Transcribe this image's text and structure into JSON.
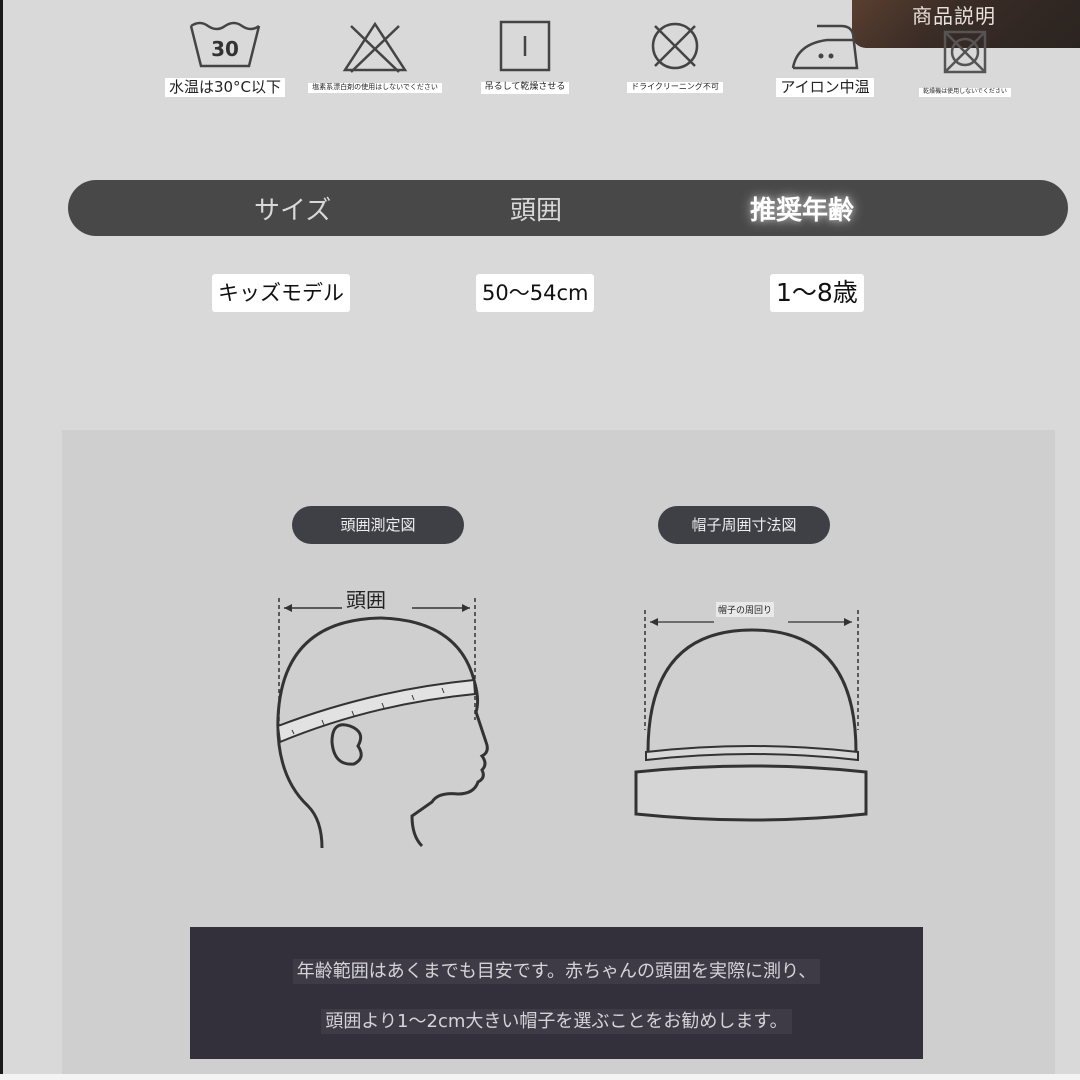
{
  "overlay": {
    "label": "商品説明"
  },
  "care": [
    {
      "icon": "wash-30-icon",
      "label": "水温は30°C以下",
      "number": "30"
    },
    {
      "icon": "no-bleach-icon",
      "label": "塩素系漂白剤の使用はしないでください"
    },
    {
      "icon": "hang-dry-icon",
      "label": "吊るして乾燥させる"
    },
    {
      "icon": "no-dry-clean-icon",
      "label": "ドライクリーニング不可"
    },
    {
      "icon": "iron-medium-icon",
      "label": "アイロン中温"
    },
    {
      "icon": "no-tumble-dry-icon",
      "label": "乾燥機は使用しないでください"
    }
  ],
  "size_table": {
    "headers": [
      "サイズ",
      "頭囲",
      "推奨年齢"
    ],
    "row": [
      "キッズモデル",
      "50〜54cm",
      "1〜8歳"
    ]
  },
  "diagrams": {
    "head": {
      "title": "頭囲測定図",
      "label": "頭囲"
    },
    "hat": {
      "title": "帽子周囲寸法図",
      "label": "帽子の周回り"
    }
  },
  "notice": {
    "line1": "年齢範囲はあくまでも目安です。赤ちゃんの頭囲を実際に測り、",
    "line2": "頭囲より1〜2cm大きい帽子を選ぶことをお勧めします。"
  }
}
